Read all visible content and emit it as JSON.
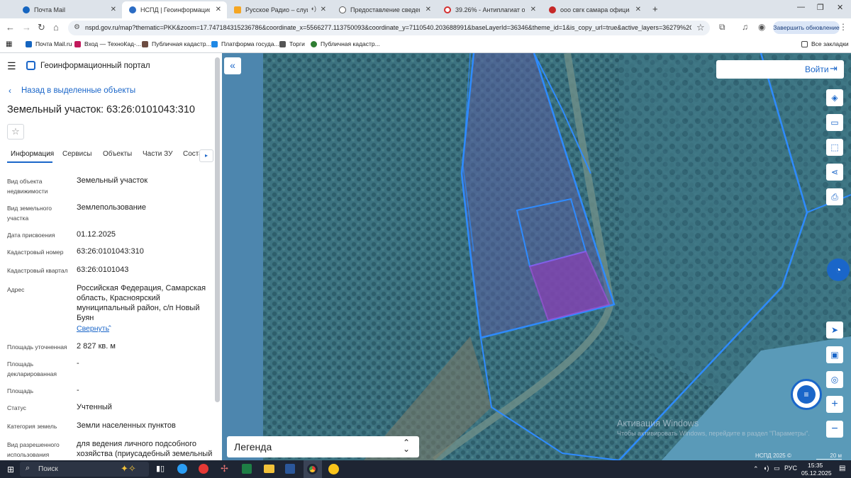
{
  "browser": {
    "tabs": [
      {
        "label": "Почта Mail",
        "color": "#1565c0"
      },
      {
        "label": "НСПД | Геоинформационный",
        "color": "#2b6cc4"
      },
      {
        "label": "Русское Радио – слушать",
        "color": "#f5a623"
      },
      {
        "label": "Предоставление сведений из",
        "color": "#555555"
      },
      {
        "label": "39.26% - Антиплагиат онлайн",
        "color": "#d32f2f"
      },
      {
        "label": "ооо свгк самара официальны",
        "color": "#c62828"
      }
    ],
    "new_tab": "+",
    "url": "nspd.gov.ru/map?thematic=PKK&zoom=17.747184315236786&coordinate_x=5566277.113750093&coordinate_y=7110540.203688991&baseLayerId=36346&theme_id=1&is_copy_url=true&active_layers=36279%2C36278...",
    "update_button": "Завершить обновление",
    "bookmarks": [
      {
        "label": "Почта Mail.ru",
        "color": "#1565c0"
      },
      {
        "label": "Вход — ТехноКад-...",
        "color": "#c2185b"
      },
      {
        "label": "Публичная кадастр...",
        "color": "#6d4c41"
      },
      {
        "label": "Платформа госуда...",
        "color": "#1e88e5"
      },
      {
        "label": "Торги",
        "color": "#555555"
      },
      {
        "label": "Публичная кадастр...",
        "color": "#2e7d32"
      }
    ],
    "all_bookmarks": "Все закладки"
  },
  "sidebar": {
    "app_title": "Геоинформационный портал",
    "back_link": "Назад в выделенные объекты",
    "heading": "Земельный участок: 63:26:0101043:310",
    "tabs": [
      "Информация",
      "Сервисы",
      "Объекты",
      "Части ЗУ",
      "Соста"
    ],
    "fields": [
      {
        "label": "Вид объекта недвижимости",
        "value": "Земельный участок"
      },
      {
        "label": "Вид земельного участка",
        "value": "Землепользование"
      },
      {
        "label": "Дата присвоения",
        "value": "01.12.2025"
      },
      {
        "label": "Кадастровый номер",
        "value": "63:26:0101043:310"
      },
      {
        "label": "Кадастровый квартал",
        "value": "63:26:0101043"
      },
      {
        "label": "Адрес",
        "value": "Российская Федерация, Самарская область, Красноярский муниципальный район, с/п Новый Буян"
      },
      {
        "label": "Площадь уточненная",
        "value": "2 827 кв. м"
      },
      {
        "label": "Площадь декларированная",
        "value": "-"
      },
      {
        "label": "Площадь",
        "value": "-"
      },
      {
        "label": "Статус",
        "value": "Учтенный"
      },
      {
        "label": "Категория земель",
        "value": "Земли населенных пунктов"
      },
      {
        "label": "Вид разрешенного использования",
        "value": "для ведения личного подсобного хозяйства (приусадебный земельный"
      }
    ],
    "collapse_link": "Свернуть"
  },
  "map": {
    "login_button": "Войти",
    "legend_label": "Легенда",
    "watermark_title": "Активация Windows",
    "watermark_text": "Чтобы активировать Windows, перейдите в раздел \"Параметры\".",
    "copyright": "НСПД 2025 ©",
    "scale": "20 м"
  },
  "taskbar": {
    "search": "Поиск",
    "lang": "РУС",
    "time": "15:35",
    "date": "05.12.2025"
  }
}
